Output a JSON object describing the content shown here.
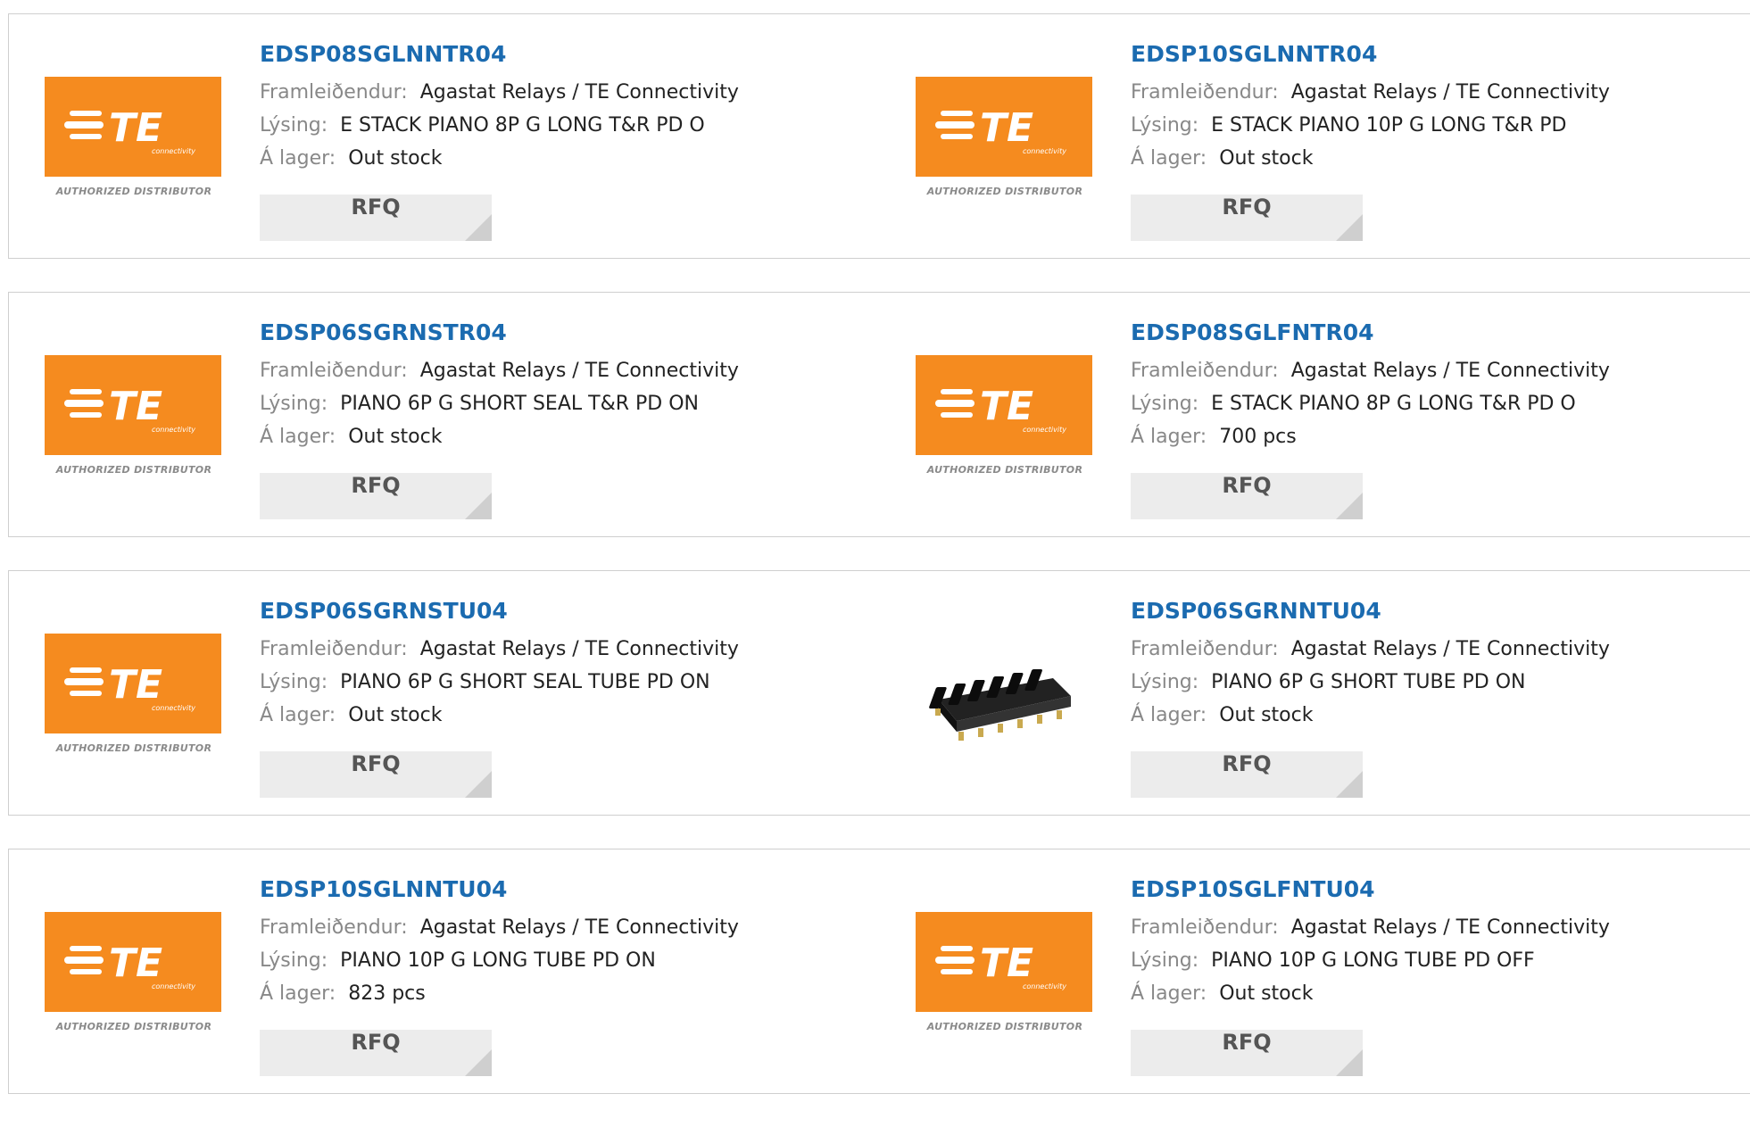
{
  "labels": {
    "manufacturer": "Framleiðendur:",
    "description": "Lýsing:",
    "stock": "Á lager:",
    "rfq": "RFQ",
    "authorized": "AUTHORIZED DISTRIBUTOR",
    "te_logo": "TE",
    "te_sub": "connectivity"
  },
  "colors": {
    "brand_orange": "#f58b1f",
    "part_link_blue": "#1b6bb0"
  },
  "products": [
    {
      "part": "EDSP08SGLNNTR04",
      "manufacturer": "Agastat Relays / TE Connectivity",
      "description": "E STACK PIANO 8P G LONG T&R PD O",
      "stock": "Out stock",
      "image": "te-logo"
    },
    {
      "part": "EDSP10SGLNNTR04",
      "manufacturer": "Agastat Relays / TE Connectivity",
      "description": "E STACK PIANO 10P G LONG T&R PD",
      "stock": "Out stock",
      "image": "te-logo"
    },
    {
      "part": "EDSP06SGRNSTR04",
      "manufacturer": "Agastat Relays / TE Connectivity",
      "description": "PIANO 6P G SHORT SEAL T&R PD ON",
      "stock": "Out stock",
      "image": "te-logo"
    },
    {
      "part": "EDSP08SGLFNTR04",
      "manufacturer": "Agastat Relays / TE Connectivity",
      "description": "E STACK PIANO 8P G LONG T&R PD O",
      "stock": "700 pcs",
      "image": "te-logo"
    },
    {
      "part": "EDSP06SGRNSTU04",
      "manufacturer": "Agastat Relays / TE Connectivity",
      "description": "PIANO 6P G SHORT SEAL TUBE PD ON",
      "stock": "Out stock",
      "image": "te-logo"
    },
    {
      "part": "EDSP06SGRNNTU04",
      "manufacturer": "Agastat Relays / TE Connectivity",
      "description": "PIANO 6P G SHORT TUBE PD ON",
      "stock": "Out stock",
      "image": "dip-switch-photo"
    },
    {
      "part": "EDSP10SGLNNTU04",
      "manufacturer": "Agastat Relays / TE Connectivity",
      "description": "PIANO 10P G LONG TUBE PD ON",
      "stock": "823 pcs",
      "image": "te-logo"
    },
    {
      "part": "EDSP10SGLFNTU04",
      "manufacturer": "Agastat Relays / TE Connectivity",
      "description": "PIANO 10P G LONG TUBE PD OFF",
      "stock": "Out stock",
      "image": "te-logo"
    }
  ]
}
